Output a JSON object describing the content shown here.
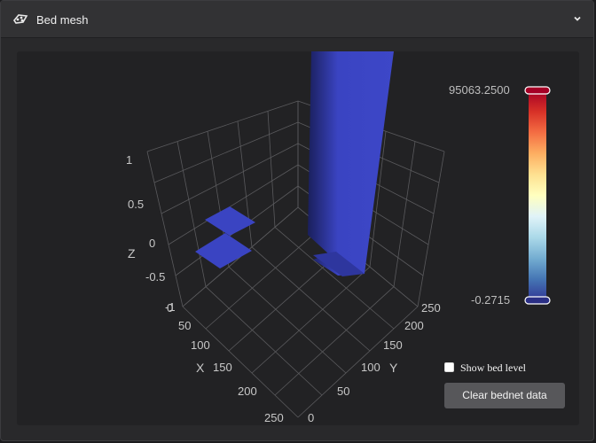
{
  "header": {
    "title": "Bed mesh",
    "icon": "bed-mesh-icon",
    "expand_icon": "chevron-down-icon"
  },
  "colorbar": {
    "max_label": "95063.2500",
    "min_label": "-0.2715",
    "colors": [
      "#a50026",
      "#d73027",
      "#f46d43",
      "#fdae61",
      "#fee090",
      "#ffffbf",
      "#e0f3f8",
      "#abd9e9",
      "#74add1",
      "#4575b4",
      "#313695"
    ]
  },
  "axes": {
    "x_label": "X",
    "y_label": "Y",
    "z_label": "Z",
    "x_ticks": [
      "0",
      "50",
      "100",
      "150",
      "200",
      "250"
    ],
    "y_ticks": [
      "0",
      "50",
      "100",
      "150",
      "200",
      "250"
    ],
    "z_ticks": [
      "1",
      "0.5",
      "0",
      "-0.5",
      "-1"
    ]
  },
  "controls": {
    "show_bed_level_label": "Show bed level",
    "show_bed_level_checked": false,
    "clear_button_label": "Clear bednet data"
  },
  "colors": {
    "surface": "#3a44c2",
    "panel_bg": "#29292b",
    "grid": "#5a5a5d"
  }
}
